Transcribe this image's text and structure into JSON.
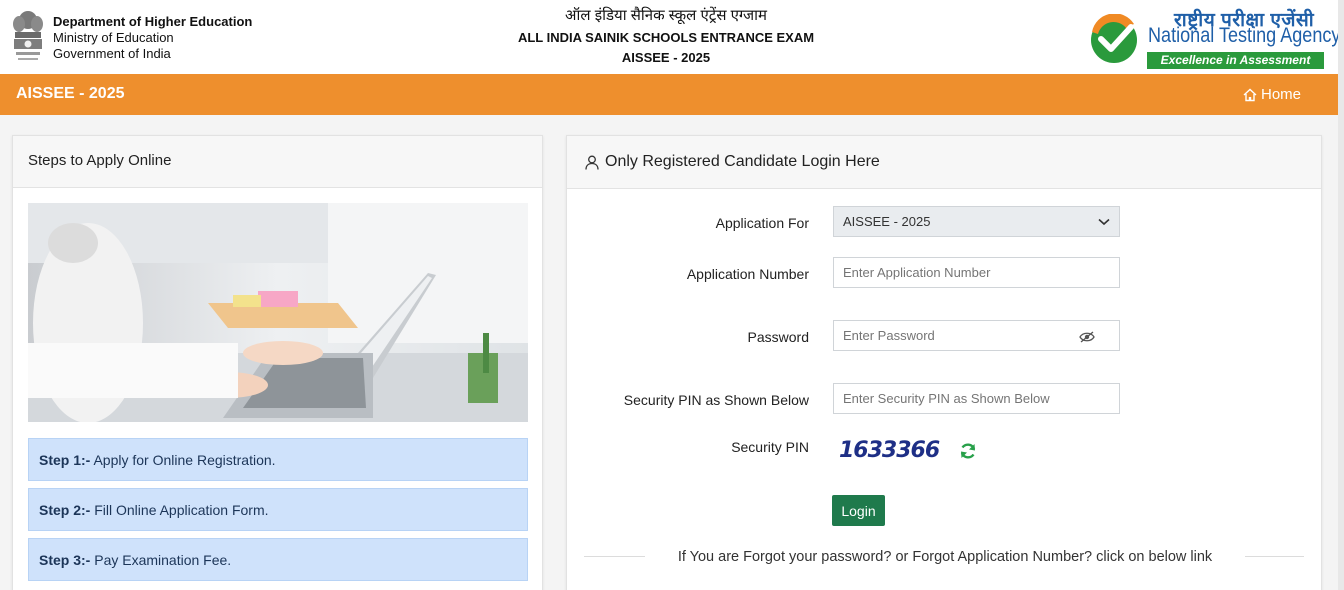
{
  "header": {
    "dept_name": "Department of Higher Education",
    "ministry": "Ministry of Education",
    "government": "Government of India",
    "title_hindi": "ऑल इंडिया सैनिक स्कूल एंट्रेंस एग्जाम",
    "title_english": "ALL INDIA SAINIK SCHOOLS ENTRANCE EXAM",
    "exam_year": "AISSEE - 2025",
    "nta_hindi": "राष्ट्रीय परीक्षा एजेंसी",
    "nta_english": "National Testing Agency",
    "nta_tagline": "Excellence in Assessment"
  },
  "navbar": {
    "brand": "AISSEE - 2025",
    "home_label": "Home"
  },
  "steps_panel": {
    "title": "Steps to Apply Online",
    "steps": [
      {
        "label": "Step 1:-",
        "text": " Apply for Online Registration."
      },
      {
        "label": "Step 2:-",
        "text": " Fill Online Application Form."
      },
      {
        "label": "Step 3:-",
        "text": " Pay Examination Fee."
      }
    ]
  },
  "login_panel": {
    "title": "Only Registered Candidate Login Here",
    "application_for_label": "Application For",
    "application_for_value": "AISSEE - 2025",
    "application_number_label": "Application Number",
    "application_number_placeholder": "Enter Application Number",
    "password_label": "Password",
    "password_placeholder": "Enter Password",
    "security_pin_input_label": "Security PIN as Shown Below",
    "security_pin_placeholder": "Enter Security PIN as Shown Below",
    "security_pin_label": "Security PIN",
    "captcha_text": "1633366",
    "login_button": "Login",
    "forgot_text": "If You are Forgot your password? or Forgot Application Number? click on below link"
  },
  "colors": {
    "navbar_bg": "#ee8f2d",
    "step_bg": "#cfe2fb",
    "login_button_bg": "#1f7a4c",
    "nta_blue": "#1f5fa8",
    "nta_green": "#2a9a3c"
  }
}
